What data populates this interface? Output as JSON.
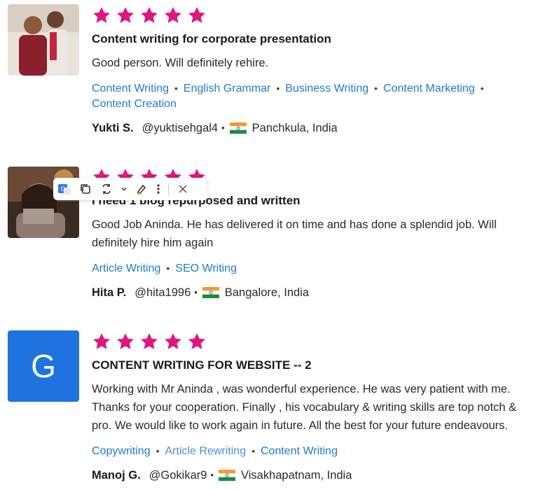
{
  "reviews": [
    {
      "rating": 5,
      "title": "Content writing for corporate presentation",
      "text": "Good person. Will definitely rehire.",
      "skills": [
        "Content Writing",
        "English Grammar",
        "Business Writing",
        "Content Marketing",
        "Content Creation"
      ],
      "name": "Yukti S.",
      "handle": "@yuktisehgal4",
      "location": "Panchkula, India"
    },
    {
      "rating": 5,
      "title": "I need 1 blog repurposed and written",
      "text": "Good Job Aninda. He has delivered it on time and has done a splendid job. Will definitely hire him again",
      "skills": [
        "Article Writing",
        "SEO Writing"
      ],
      "name": "Hita P.",
      "handle": "@hita1996",
      "location": "Bangalore, India"
    },
    {
      "rating": 5,
      "avatar_letter": "G",
      "title": "CONTENT WRITING FOR WEBSITE -- 2",
      "text": "Working with Mr Aninda , was wonderful experience. He was very patient with me. Thanks for your cooperation. Finally , his vocabulary & writing skills are top notch & pro. We would like to work again in future. All the best for your future endeavours.",
      "skills": [
        "Copywriting",
        "Article Rewriting",
        "Content Writing"
      ],
      "name": "Manoj G.",
      "handle": "@Gokikar9",
      "location": "Visakhapatnam, India"
    }
  ],
  "colors": {
    "star": "#e0157f",
    "link": "#1f7bc9",
    "avatar_bg": "#1f73e0"
  }
}
